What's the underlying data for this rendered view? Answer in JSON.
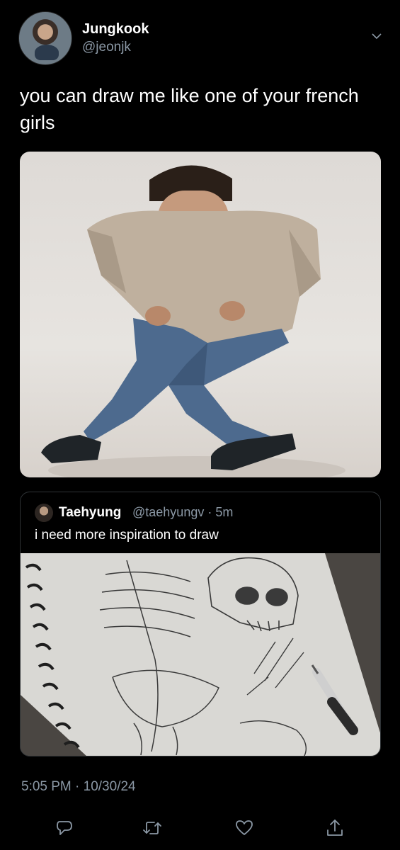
{
  "author": {
    "display_name": "Jungkook",
    "handle": "@jeonjk"
  },
  "tweet": {
    "text": "you can draw me like one of your french girls"
  },
  "quoted_tweet": {
    "display_name": "Taehyung",
    "meta": "@taehyungv · 5m",
    "text": "i need more inspiration to draw"
  },
  "footer": {
    "timestamp": "5:05 PM · 10/30/24"
  },
  "actions": {
    "reply": "reply-icon",
    "retweet": "retweet-icon",
    "like": "heart-icon",
    "share": "share-icon"
  },
  "colors": {
    "background": "#000000",
    "text": "#ffffff",
    "muted": "#8b98a5",
    "border": "#2f3336"
  }
}
